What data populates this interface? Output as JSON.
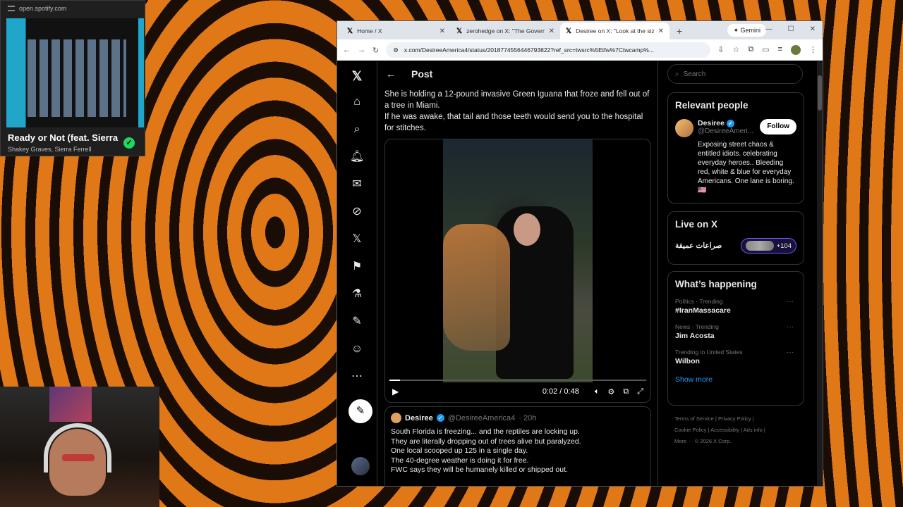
{
  "spotify": {
    "url": "open.spotify.com",
    "song_title": "Ready or Not (feat. Sierra",
    "artists": "Shakey Graves, Sierra Ferrell"
  },
  "browser": {
    "tabs": [
      {
        "label": "Home / X"
      },
      {
        "label": "zerohedge on X: \"The Governm"
      },
      {
        "label": "Desiree on X: \"Look at the size"
      }
    ],
    "gemini_label": "Gemini",
    "address": "x.com/DesireeAmerica4/status/2018774556446793822?ref_src=twsrc%5Etfw%7Ctwcamp%..."
  },
  "post": {
    "header_title": "Post",
    "tweet_text_1": "She is holding a 12-pound invasive Green Iguana that froze and fell out of a tree in Miami.",
    "tweet_text_2": "If he was awake, that tail and those teeth would send you to the hospital for stitches.",
    "video": {
      "time": "0:02 / 0:48",
      "progress": 0.042
    },
    "quote": {
      "name": "Desiree",
      "handle": "@DesireeAmerica4",
      "age": "· 20h",
      "lines": [
        "South Florida is freezing... and the reptiles are locking up.",
        "They are literally dropping out of trees alive but paralyzed.",
        "One local scooped up 125 in a single day.",
        "The 40-degree weather is doing it for free.",
        "FWC says they will be humanely killed or shipped out."
      ]
    }
  },
  "sidebar": {
    "search_placeholder": "Search",
    "relevant": {
      "title": "Relevant people",
      "name": "Desiree",
      "handle": "@DesireeAmeri...",
      "follow_label": "Follow",
      "bio": "Exposing street chaos & entitled idiots. celebrating everyday heroes.. Bleeding red, white & blue for everyday Americans. One lane is boring.🇺🇸"
    },
    "live": {
      "title": "Live on X",
      "space_name": "صراعات عميقة",
      "count": "+104"
    },
    "happening": {
      "title": "What’s happening",
      "trends": [
        {
          "meta": "Politics · Trending",
          "name": "#IranMassacare"
        },
        {
          "meta": "News · Trending",
          "name": "Jim Acosta"
        },
        {
          "meta": "Trending in United States",
          "name": "Wilbon"
        }
      ],
      "show_more": "Show more"
    },
    "footer": {
      "line1": "Terms of Service  |   Privacy Policy  |",
      "line2": "Cookie Policy  |   Accessibility  |   Ads info  |",
      "line3": "More ···   © 2026 X Corp."
    }
  }
}
